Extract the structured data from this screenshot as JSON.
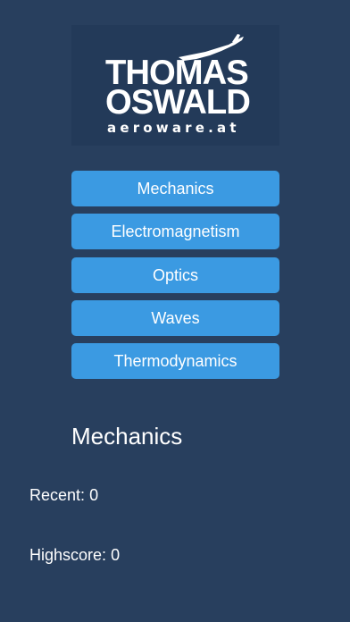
{
  "logo": {
    "line1": "THOMAS",
    "line2": "OSWALD",
    "url": "aeroware.at",
    "icon": "glider-icon"
  },
  "menu": [
    {
      "label": "Mechanics"
    },
    {
      "label": "Electromagnetism"
    },
    {
      "label": "Optics"
    },
    {
      "label": "Waves"
    },
    {
      "label": "Thermodynamics"
    }
  ],
  "section": {
    "title": "Mechanics"
  },
  "stats": {
    "recent_label": "Recent:",
    "recent_value": "0",
    "highscore_label": "Highscore:",
    "highscore_value": "0"
  },
  "colors": {
    "background": "#283f5e",
    "button": "#3b9ae2",
    "text": "#ffffff"
  }
}
